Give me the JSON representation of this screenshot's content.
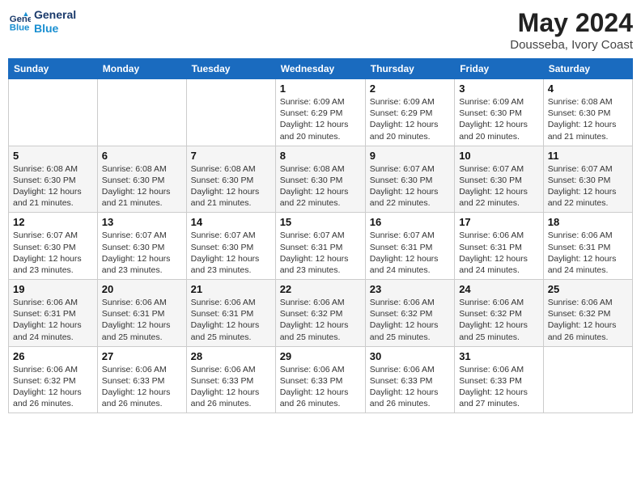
{
  "logo": {
    "line1": "General",
    "line2": "Blue"
  },
  "title": "May 2024",
  "location": "Dousseba, Ivory Coast",
  "days_header": [
    "Sunday",
    "Monday",
    "Tuesday",
    "Wednesday",
    "Thursday",
    "Friday",
    "Saturday"
  ],
  "weeks": [
    [
      {
        "num": "",
        "info": ""
      },
      {
        "num": "",
        "info": ""
      },
      {
        "num": "",
        "info": ""
      },
      {
        "num": "1",
        "info": "Sunrise: 6:09 AM\nSunset: 6:29 PM\nDaylight: 12 hours\nand 20 minutes."
      },
      {
        "num": "2",
        "info": "Sunrise: 6:09 AM\nSunset: 6:29 PM\nDaylight: 12 hours\nand 20 minutes."
      },
      {
        "num": "3",
        "info": "Sunrise: 6:09 AM\nSunset: 6:30 PM\nDaylight: 12 hours\nand 20 minutes."
      },
      {
        "num": "4",
        "info": "Sunrise: 6:08 AM\nSunset: 6:30 PM\nDaylight: 12 hours\nand 21 minutes."
      }
    ],
    [
      {
        "num": "5",
        "info": "Sunrise: 6:08 AM\nSunset: 6:30 PM\nDaylight: 12 hours\nand 21 minutes."
      },
      {
        "num": "6",
        "info": "Sunrise: 6:08 AM\nSunset: 6:30 PM\nDaylight: 12 hours\nand 21 minutes."
      },
      {
        "num": "7",
        "info": "Sunrise: 6:08 AM\nSunset: 6:30 PM\nDaylight: 12 hours\nand 21 minutes."
      },
      {
        "num": "8",
        "info": "Sunrise: 6:08 AM\nSunset: 6:30 PM\nDaylight: 12 hours\nand 22 minutes."
      },
      {
        "num": "9",
        "info": "Sunrise: 6:07 AM\nSunset: 6:30 PM\nDaylight: 12 hours\nand 22 minutes."
      },
      {
        "num": "10",
        "info": "Sunrise: 6:07 AM\nSunset: 6:30 PM\nDaylight: 12 hours\nand 22 minutes."
      },
      {
        "num": "11",
        "info": "Sunrise: 6:07 AM\nSunset: 6:30 PM\nDaylight: 12 hours\nand 22 minutes."
      }
    ],
    [
      {
        "num": "12",
        "info": "Sunrise: 6:07 AM\nSunset: 6:30 PM\nDaylight: 12 hours\nand 23 minutes."
      },
      {
        "num": "13",
        "info": "Sunrise: 6:07 AM\nSunset: 6:30 PM\nDaylight: 12 hours\nand 23 minutes."
      },
      {
        "num": "14",
        "info": "Sunrise: 6:07 AM\nSunset: 6:30 PM\nDaylight: 12 hours\nand 23 minutes."
      },
      {
        "num": "15",
        "info": "Sunrise: 6:07 AM\nSunset: 6:31 PM\nDaylight: 12 hours\nand 23 minutes."
      },
      {
        "num": "16",
        "info": "Sunrise: 6:07 AM\nSunset: 6:31 PM\nDaylight: 12 hours\nand 24 minutes."
      },
      {
        "num": "17",
        "info": "Sunrise: 6:06 AM\nSunset: 6:31 PM\nDaylight: 12 hours\nand 24 minutes."
      },
      {
        "num": "18",
        "info": "Sunrise: 6:06 AM\nSunset: 6:31 PM\nDaylight: 12 hours\nand 24 minutes."
      }
    ],
    [
      {
        "num": "19",
        "info": "Sunrise: 6:06 AM\nSunset: 6:31 PM\nDaylight: 12 hours\nand 24 minutes."
      },
      {
        "num": "20",
        "info": "Sunrise: 6:06 AM\nSunset: 6:31 PM\nDaylight: 12 hours\nand 25 minutes."
      },
      {
        "num": "21",
        "info": "Sunrise: 6:06 AM\nSunset: 6:31 PM\nDaylight: 12 hours\nand 25 minutes."
      },
      {
        "num": "22",
        "info": "Sunrise: 6:06 AM\nSunset: 6:32 PM\nDaylight: 12 hours\nand 25 minutes."
      },
      {
        "num": "23",
        "info": "Sunrise: 6:06 AM\nSunset: 6:32 PM\nDaylight: 12 hours\nand 25 minutes."
      },
      {
        "num": "24",
        "info": "Sunrise: 6:06 AM\nSunset: 6:32 PM\nDaylight: 12 hours\nand 25 minutes."
      },
      {
        "num": "25",
        "info": "Sunrise: 6:06 AM\nSunset: 6:32 PM\nDaylight: 12 hours\nand 26 minutes."
      }
    ],
    [
      {
        "num": "26",
        "info": "Sunrise: 6:06 AM\nSunset: 6:32 PM\nDaylight: 12 hours\nand 26 minutes."
      },
      {
        "num": "27",
        "info": "Sunrise: 6:06 AM\nSunset: 6:33 PM\nDaylight: 12 hours\nand 26 minutes."
      },
      {
        "num": "28",
        "info": "Sunrise: 6:06 AM\nSunset: 6:33 PM\nDaylight: 12 hours\nand 26 minutes."
      },
      {
        "num": "29",
        "info": "Sunrise: 6:06 AM\nSunset: 6:33 PM\nDaylight: 12 hours\nand 26 minutes."
      },
      {
        "num": "30",
        "info": "Sunrise: 6:06 AM\nSunset: 6:33 PM\nDaylight: 12 hours\nand 26 minutes."
      },
      {
        "num": "31",
        "info": "Sunrise: 6:06 AM\nSunset: 6:33 PM\nDaylight: 12 hours\nand 27 minutes."
      },
      {
        "num": "",
        "info": ""
      }
    ]
  ]
}
